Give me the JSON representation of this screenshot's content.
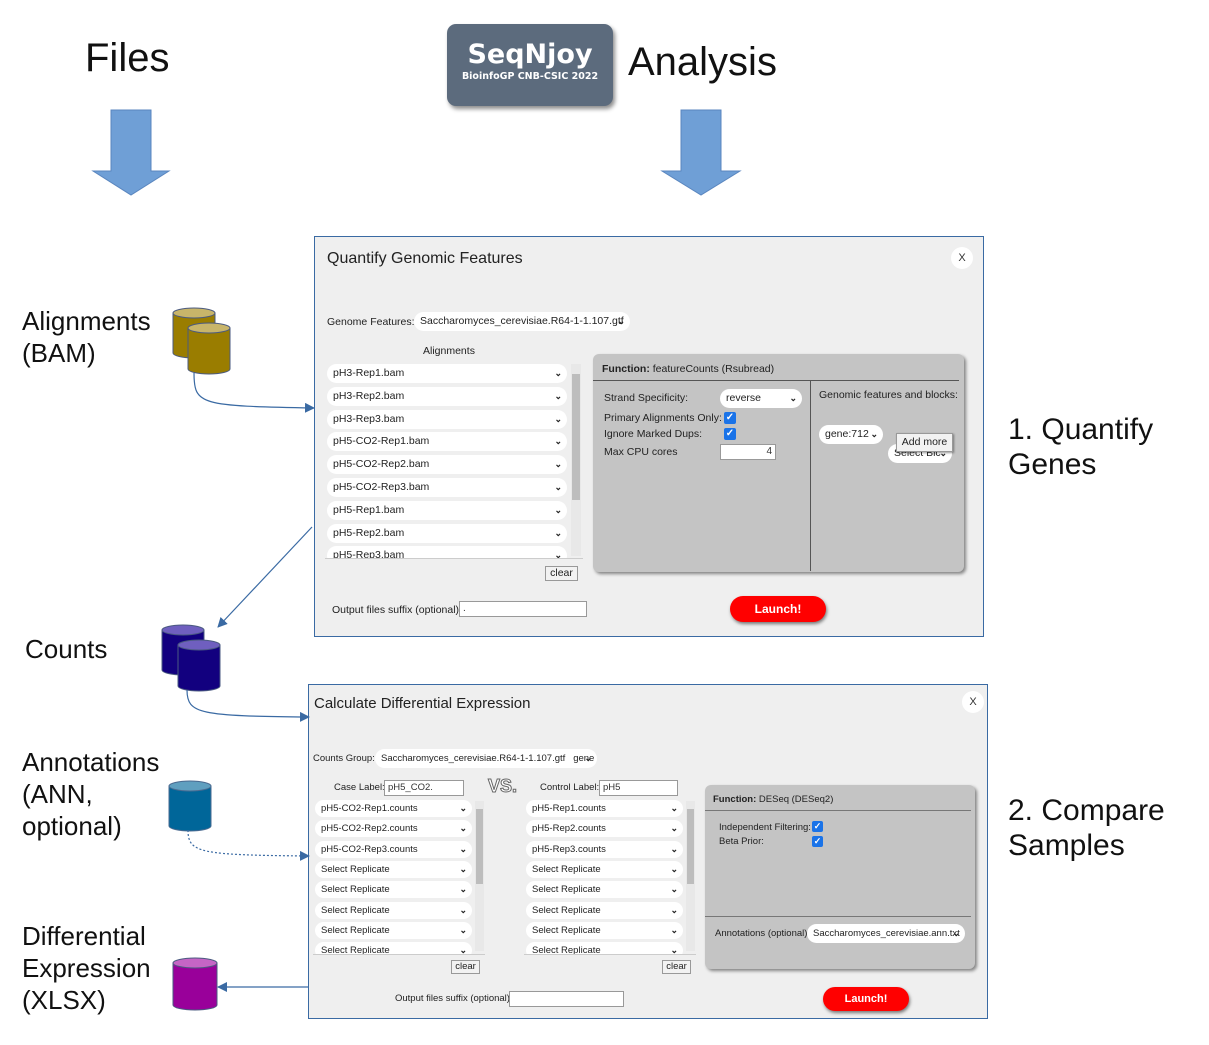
{
  "headers": {
    "files": "Files",
    "analysis": "Analysis"
  },
  "logo": {
    "name": "SeqNjoy",
    "subtitle": "BioinfoGP CNB-CSIC 2022"
  },
  "left_labels": {
    "alignments": [
      "Alignments",
      "(BAM)"
    ],
    "counts": [
      "Counts"
    ],
    "annotations": [
      "Annotations",
      "(ANN,",
      "optional)"
    ],
    "diffexp": [
      "Differential",
      "Expression",
      "(XLSX)"
    ]
  },
  "right_labels": {
    "step1": [
      "1. Quantify",
      "Genes"
    ],
    "step2": [
      "2. Compare",
      "Samples"
    ]
  },
  "colors": {
    "arrow_fill": "#6f9fd6",
    "connector": "#3a6aa3",
    "db_alignments": "#9a7d00",
    "db_counts": "#12007f",
    "db_annotations": "#006699",
    "db_diffexp": "#99009a",
    "launch": "#ff0000",
    "logo_bg": "#5c6b7d"
  },
  "quantify": {
    "title": "Quantify Genomic Features",
    "close": "X",
    "genome_features_label": "Genome Features:",
    "genome_features_value": "Saccharomyces_cerevisiae.R64-1-1.107.gtf",
    "alignments_header": "Alignments",
    "alignments": [
      "pH3-Rep1.bam",
      "pH3-Rep2.bam",
      "pH3-Rep3.bam",
      "pH5-CO2-Rep1.bam",
      "pH5-CO2-Rep2.bam",
      "pH5-CO2-Rep3.bam",
      "pH5-Rep1.bam",
      "pH5-Rep2.bam",
      "pH5-Rep3.bam"
    ],
    "clear": "clear",
    "function_label": "Function:",
    "function_value": "featureCounts (Rsubread)",
    "strand_label": "Strand Specificity:",
    "strand_value": "reverse",
    "primary_label": "Primary Alignments Only:",
    "primary_checked": true,
    "dups_label": "Ignore Marked Dups:",
    "dups_checked": true,
    "cpu_label": "Max CPU cores",
    "cpu_value": "4",
    "features_blocks_label": "Genomic features and blocks:",
    "feature_value": "gene:712",
    "block_value": "Select Blc",
    "add_more": "Add more",
    "suffix_label": "Output files suffix (optional):",
    "suffix_value": ".",
    "launch": "Launch!"
  },
  "diffexp": {
    "title": "Calculate Differential Expression",
    "close": "X",
    "counts_group_label": "Counts Group:",
    "counts_group_value": "Saccharomyces_cerevisiae.R64-1-1.107.gtf   gene",
    "case_label": "Case Label:",
    "case_value": "pH5_CO2.",
    "vs": "VS.",
    "control_label": "Control Label:",
    "control_value": "pH5",
    "case_items": [
      "pH5-CO2-Rep1.counts",
      "pH5-CO2-Rep2.counts",
      "pH5-CO2-Rep3.counts",
      "Select Replicate",
      "Select Replicate",
      "Select Replicate",
      "Select Replicate",
      "Select Replicate"
    ],
    "control_items": [
      "pH5-Rep1.counts",
      "pH5-Rep2.counts",
      "pH5-Rep3.counts",
      "Select Replicate",
      "Select Replicate",
      "Select Replicate",
      "Select Replicate",
      "Select Replicate"
    ],
    "clear": "clear",
    "function_label": "Function:",
    "function_value": "DESeq (DESeq2)",
    "indep_label": "Independent Filtering:",
    "indep_checked": true,
    "beta_label": "Beta Prior:",
    "beta_checked": true,
    "annotations_label": "Annotations (optional)",
    "annotations_value": "Saccharomyces_cerevisiae.ann.txt",
    "suffix_label": "Output files suffix (optional):",
    "suffix_value": "",
    "launch": "Launch!"
  }
}
